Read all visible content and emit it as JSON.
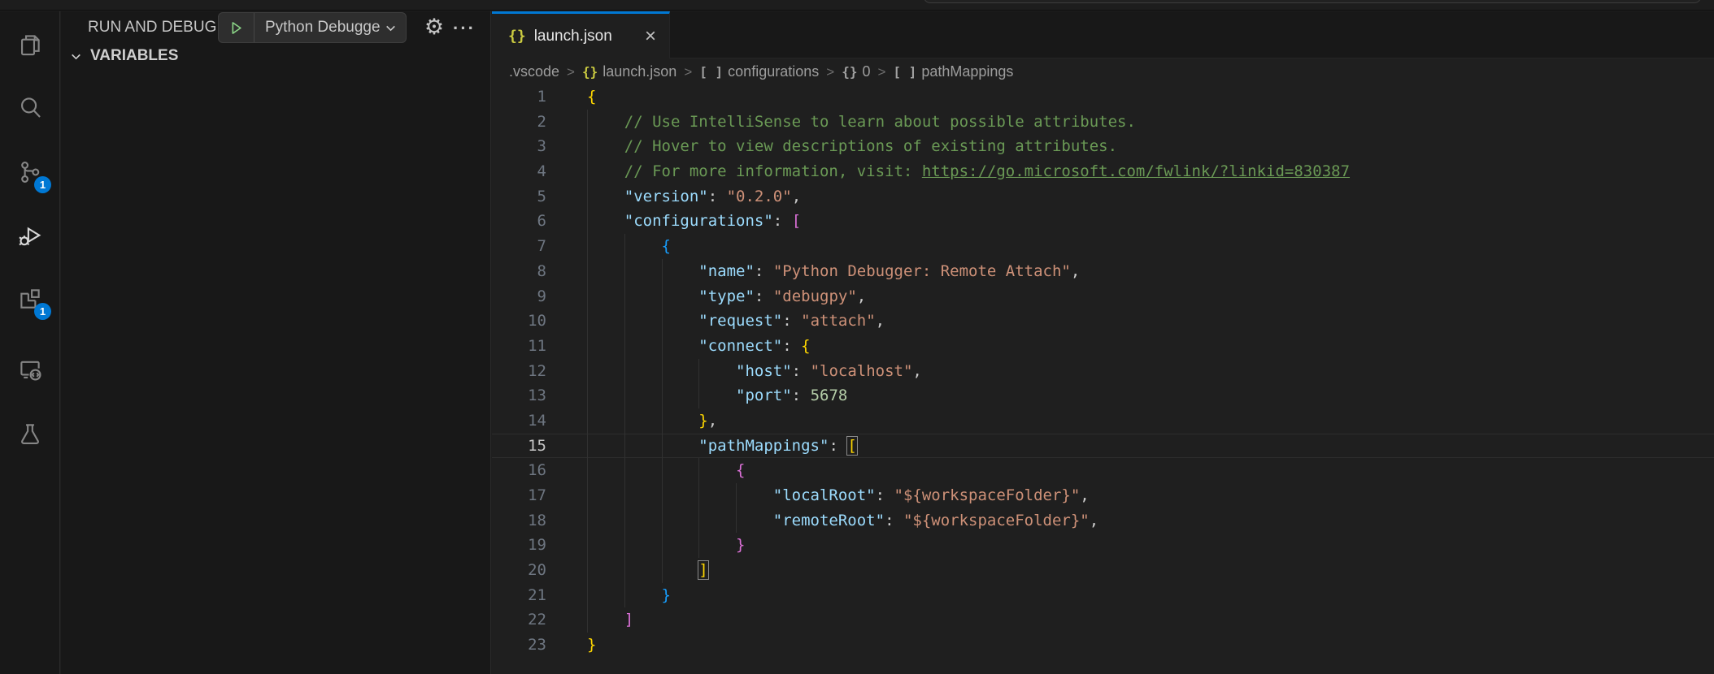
{
  "colors": {
    "editor_bg": "#1f1f1f",
    "panel_bg": "#181818",
    "border": "#2b2b2b",
    "accent_blue": "#0078d4",
    "badge_blue": "#0078d4",
    "play_green": "#89d185",
    "json_icon_yellow": "#cbcb41",
    "comment_green": "#6a9955",
    "key_blue": "#9cdcfe",
    "string_orange": "#ce9178",
    "number_green": "#b5cea8",
    "bracket_gold": "#ffd700",
    "bracket_pink": "#da70d6",
    "bracket_blue": "#179fff"
  },
  "activity_bar": {
    "items": [
      {
        "name": "explorer",
        "icon": "files-icon",
        "badge": "",
        "active": false
      },
      {
        "name": "search",
        "icon": "search-icon",
        "badge": "",
        "active": false
      },
      {
        "name": "source-control",
        "icon": "source-control-icon",
        "badge": "1",
        "active": false
      },
      {
        "name": "run-and-debug",
        "icon": "debug-icon",
        "badge": "",
        "active": true
      },
      {
        "name": "extensions",
        "icon": "extensions-icon",
        "badge": "1",
        "active": false
      },
      {
        "name": "remote-explorer",
        "icon": "remote-explorer-icon",
        "badge": "",
        "active": false
      },
      {
        "name": "testing",
        "icon": "beaker-icon",
        "badge": "",
        "active": false
      }
    ]
  },
  "sidebar": {
    "header": "RUN AND DEBUG",
    "config_picker": {
      "label": "Python Debugge"
    },
    "more_actions": "···",
    "gear_glyph": "⚙",
    "sections": [
      {
        "label": "VARIABLES",
        "expanded": true
      }
    ]
  },
  "editor": {
    "tab": {
      "icon": "{}",
      "label": "launch.json",
      "close": "×"
    },
    "breadcrumb": [
      {
        "icon": "",
        "icon_style": "",
        "label": ".vscode"
      },
      {
        "icon": "{}",
        "icon_style": "yellow",
        "label": "launch.json"
      },
      {
        "icon": "[ ]",
        "icon_style": "gray",
        "label": "configurations"
      },
      {
        "icon": "{}",
        "icon_style": "gray",
        "label": "0"
      },
      {
        "icon": "[ ]",
        "icon_style": "gray",
        "label": "pathMappings"
      }
    ],
    "breadcrumb_separator": ">",
    "code": {
      "char_width": 11.44,
      "lines": [
        {
          "num": 1,
          "guides": [],
          "current": false,
          "tokens": [
            {
              "text": "{",
              "cls": "b1"
            }
          ]
        },
        {
          "num": 2,
          "guides": [
            0
          ],
          "current": false,
          "tokens": [
            {
              "text": "    ",
              "cls": "p"
            },
            {
              "text": "// Use IntelliSense to learn about possible attributes.",
              "cls": "c"
            }
          ]
        },
        {
          "num": 3,
          "guides": [
            0
          ],
          "current": false,
          "tokens": [
            {
              "text": "    ",
              "cls": "p"
            },
            {
              "text": "// Hover to view descriptions of existing attributes.",
              "cls": "c"
            }
          ]
        },
        {
          "num": 4,
          "guides": [
            0
          ],
          "current": false,
          "tokens": [
            {
              "text": "    ",
              "cls": "p"
            },
            {
              "text": "// For more information, visit: ",
              "cls": "c"
            },
            {
              "text": "https://go.microsoft.com/fwlink/?linkid=830387",
              "cls": "l"
            }
          ]
        },
        {
          "num": 5,
          "guides": [
            0
          ],
          "current": false,
          "tokens": [
            {
              "text": "    ",
              "cls": "p"
            },
            {
              "text": "\"version\"",
              "cls": "k"
            },
            {
              "text": ": ",
              "cls": "p"
            },
            {
              "text": "\"0.2.0\"",
              "cls": "s"
            },
            {
              "text": ",",
              "cls": "p"
            }
          ]
        },
        {
          "num": 6,
          "guides": [
            0
          ],
          "current": false,
          "tokens": [
            {
              "text": "    ",
              "cls": "p"
            },
            {
              "text": "\"configurations\"",
              "cls": "k"
            },
            {
              "text": ": ",
              "cls": "p"
            },
            {
              "text": "[",
              "cls": "b2"
            }
          ]
        },
        {
          "num": 7,
          "guides": [
            0,
            4
          ],
          "current": false,
          "tokens": [
            {
              "text": "        ",
              "cls": "p"
            },
            {
              "text": "{",
              "cls": "b3"
            }
          ]
        },
        {
          "num": 8,
          "guides": [
            0,
            4,
            8
          ],
          "current": false,
          "tokens": [
            {
              "text": "            ",
              "cls": "p"
            },
            {
              "text": "\"name\"",
              "cls": "k"
            },
            {
              "text": ": ",
              "cls": "p"
            },
            {
              "text": "\"Python Debugger: Remote Attach\"",
              "cls": "s"
            },
            {
              "text": ",",
              "cls": "p"
            }
          ]
        },
        {
          "num": 9,
          "guides": [
            0,
            4,
            8
          ],
          "current": false,
          "tokens": [
            {
              "text": "            ",
              "cls": "p"
            },
            {
              "text": "\"type\"",
              "cls": "k"
            },
            {
              "text": ": ",
              "cls": "p"
            },
            {
              "text": "\"debugpy\"",
              "cls": "s"
            },
            {
              "text": ",",
              "cls": "p"
            }
          ]
        },
        {
          "num": 10,
          "guides": [
            0,
            4,
            8
          ],
          "current": false,
          "tokens": [
            {
              "text": "            ",
              "cls": "p"
            },
            {
              "text": "\"request\"",
              "cls": "k"
            },
            {
              "text": ": ",
              "cls": "p"
            },
            {
              "text": "\"attach\"",
              "cls": "s"
            },
            {
              "text": ",",
              "cls": "p"
            }
          ]
        },
        {
          "num": 11,
          "guides": [
            0,
            4,
            8
          ],
          "current": false,
          "tokens": [
            {
              "text": "            ",
              "cls": "p"
            },
            {
              "text": "\"connect\"",
              "cls": "k"
            },
            {
              "text": ": ",
              "cls": "p"
            },
            {
              "text": "{",
              "cls": "b1"
            }
          ]
        },
        {
          "num": 12,
          "guides": [
            0,
            4,
            8,
            12
          ],
          "current": false,
          "tokens": [
            {
              "text": "                ",
              "cls": "p"
            },
            {
              "text": "\"host\"",
              "cls": "k"
            },
            {
              "text": ": ",
              "cls": "p"
            },
            {
              "text": "\"localhost\"",
              "cls": "s"
            },
            {
              "text": ",",
              "cls": "p"
            }
          ]
        },
        {
          "num": 13,
          "guides": [
            0,
            4,
            8,
            12
          ],
          "current": false,
          "tokens": [
            {
              "text": "                ",
              "cls": "p"
            },
            {
              "text": "\"port\"",
              "cls": "k"
            },
            {
              "text": ": ",
              "cls": "p"
            },
            {
              "text": "5678",
              "cls": "n"
            }
          ]
        },
        {
          "num": 14,
          "guides": [
            0,
            4,
            8
          ],
          "current": false,
          "tokens": [
            {
              "text": "            ",
              "cls": "p"
            },
            {
              "text": "}",
              "cls": "b1"
            },
            {
              "text": ",",
              "cls": "p"
            }
          ]
        },
        {
          "num": 15,
          "guides": [
            0,
            4,
            8
          ],
          "current": true,
          "tokens": [
            {
              "text": "            ",
              "cls": "p"
            },
            {
              "text": "\"pathMappings\"",
              "cls": "k"
            },
            {
              "text": ": ",
              "cls": "p"
            },
            {
              "text": "[",
              "cls": "b1",
              "box": true
            }
          ]
        },
        {
          "num": 16,
          "guides": [
            0,
            4,
            8,
            12
          ],
          "current": false,
          "tokens": [
            {
              "text": "                ",
              "cls": "p"
            },
            {
              "text": "{",
              "cls": "b2"
            }
          ]
        },
        {
          "num": 17,
          "guides": [
            0,
            4,
            8,
            12,
            16
          ],
          "current": false,
          "tokens": [
            {
              "text": "                    ",
              "cls": "p"
            },
            {
              "text": "\"localRoot\"",
              "cls": "k"
            },
            {
              "text": ": ",
              "cls": "p"
            },
            {
              "text": "\"${workspaceFolder}\"",
              "cls": "s"
            },
            {
              "text": ",",
              "cls": "p"
            }
          ]
        },
        {
          "num": 18,
          "guides": [
            0,
            4,
            8,
            12,
            16
          ],
          "current": false,
          "tokens": [
            {
              "text": "                    ",
              "cls": "p"
            },
            {
              "text": "\"remoteRoot\"",
              "cls": "k"
            },
            {
              "text": ": ",
              "cls": "p"
            },
            {
              "text": "\"${workspaceFolder}\"",
              "cls": "s"
            },
            {
              "text": ",",
              "cls": "p"
            }
          ]
        },
        {
          "num": 19,
          "guides": [
            0,
            4,
            8,
            12
          ],
          "current": false,
          "tokens": [
            {
              "text": "                ",
              "cls": "p"
            },
            {
              "text": "}",
              "cls": "b2"
            }
          ]
        },
        {
          "num": 20,
          "guides": [
            0,
            4,
            8
          ],
          "current": false,
          "tokens": [
            {
              "text": "            ",
              "cls": "p"
            },
            {
              "text": "]",
              "cls": "b1",
              "box": true
            }
          ]
        },
        {
          "num": 21,
          "guides": [
            0,
            4
          ],
          "current": false,
          "tokens": [
            {
              "text": "        ",
              "cls": "p"
            },
            {
              "text": "}",
              "cls": "b3"
            }
          ]
        },
        {
          "num": 22,
          "guides": [
            0
          ],
          "current": false,
          "tokens": [
            {
              "text": "    ",
              "cls": "p"
            },
            {
              "text": "]",
              "cls": "b2"
            }
          ]
        },
        {
          "num": 23,
          "guides": [],
          "current": false,
          "tokens": [
            {
              "text": "}",
              "cls": "b1"
            }
          ]
        }
      ]
    }
  }
}
